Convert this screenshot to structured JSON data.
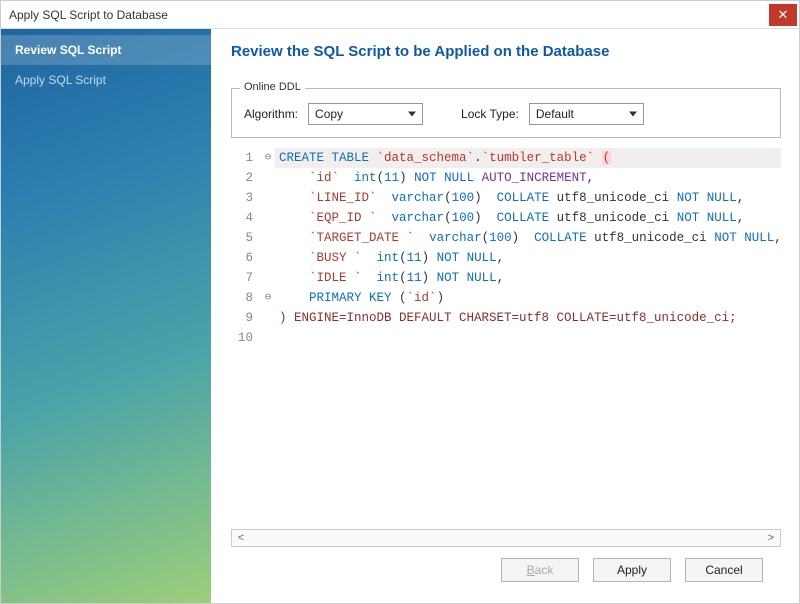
{
  "window": {
    "title": "Apply SQL Script to Database"
  },
  "sidebar": {
    "steps": [
      {
        "label": "Review SQL Script",
        "active": true
      },
      {
        "label": "Apply SQL Script",
        "active": false
      }
    ]
  },
  "heading": "Review the SQL Script to be Applied on the Database",
  "ddl": {
    "legend": "Online DDL",
    "algorithm_label": "Algorithm:",
    "algorithm_value": "Copy",
    "locktype_label": "Lock Type:",
    "locktype_value": "Default"
  },
  "sql": {
    "line_numbers": [
      "1",
      "2",
      "3",
      "4",
      "5",
      "6",
      "7",
      "8",
      "9",
      "10"
    ],
    "fold_markers": {
      "1": "⊖",
      "8": "⊖"
    },
    "schema": "data_schema",
    "table": "tumbler_table",
    "columns": [
      {
        "name": "id",
        "type": "int",
        "len": "11",
        "collate": null,
        "extra": "NOT NULL AUTO_INCREMENT"
      },
      {
        "name": "LINE_ID",
        "type": "varchar",
        "len": "100",
        "collate": "utf8_unicode_ci",
        "extra": "NOT NULL"
      },
      {
        "name": "EQP_ID ",
        "type": "varchar",
        "len": "100",
        "collate": "utf8_unicode_ci",
        "extra": "NOT NULL"
      },
      {
        "name": "TARGET_DATE ",
        "type": "varchar",
        "len": "100",
        "collate": "utf8_unicode_ci",
        "extra": "NOT NULL"
      },
      {
        "name": "BUSY ",
        "type": "int",
        "len": "11",
        "collate": null,
        "extra": "NOT NULL"
      },
      {
        "name": "IDLE ",
        "type": "int",
        "len": "11",
        "collate": null,
        "extra": "NOT NULL"
      }
    ],
    "primary_key": "id",
    "tail": ") ENGINE=InnoDB DEFAULT CHARSET=utf8 COLLATE=utf8_unicode_ci;",
    "kw": {
      "create_table": "CREATE TABLE",
      "not_null": "NOT NULL",
      "auto_increment": "AUTO_INCREMENT",
      "collate": "COLLATE",
      "primary_key": "PRIMARY KEY"
    }
  },
  "footer": {
    "back": "Back",
    "apply": "Apply",
    "cancel": "Cancel"
  }
}
